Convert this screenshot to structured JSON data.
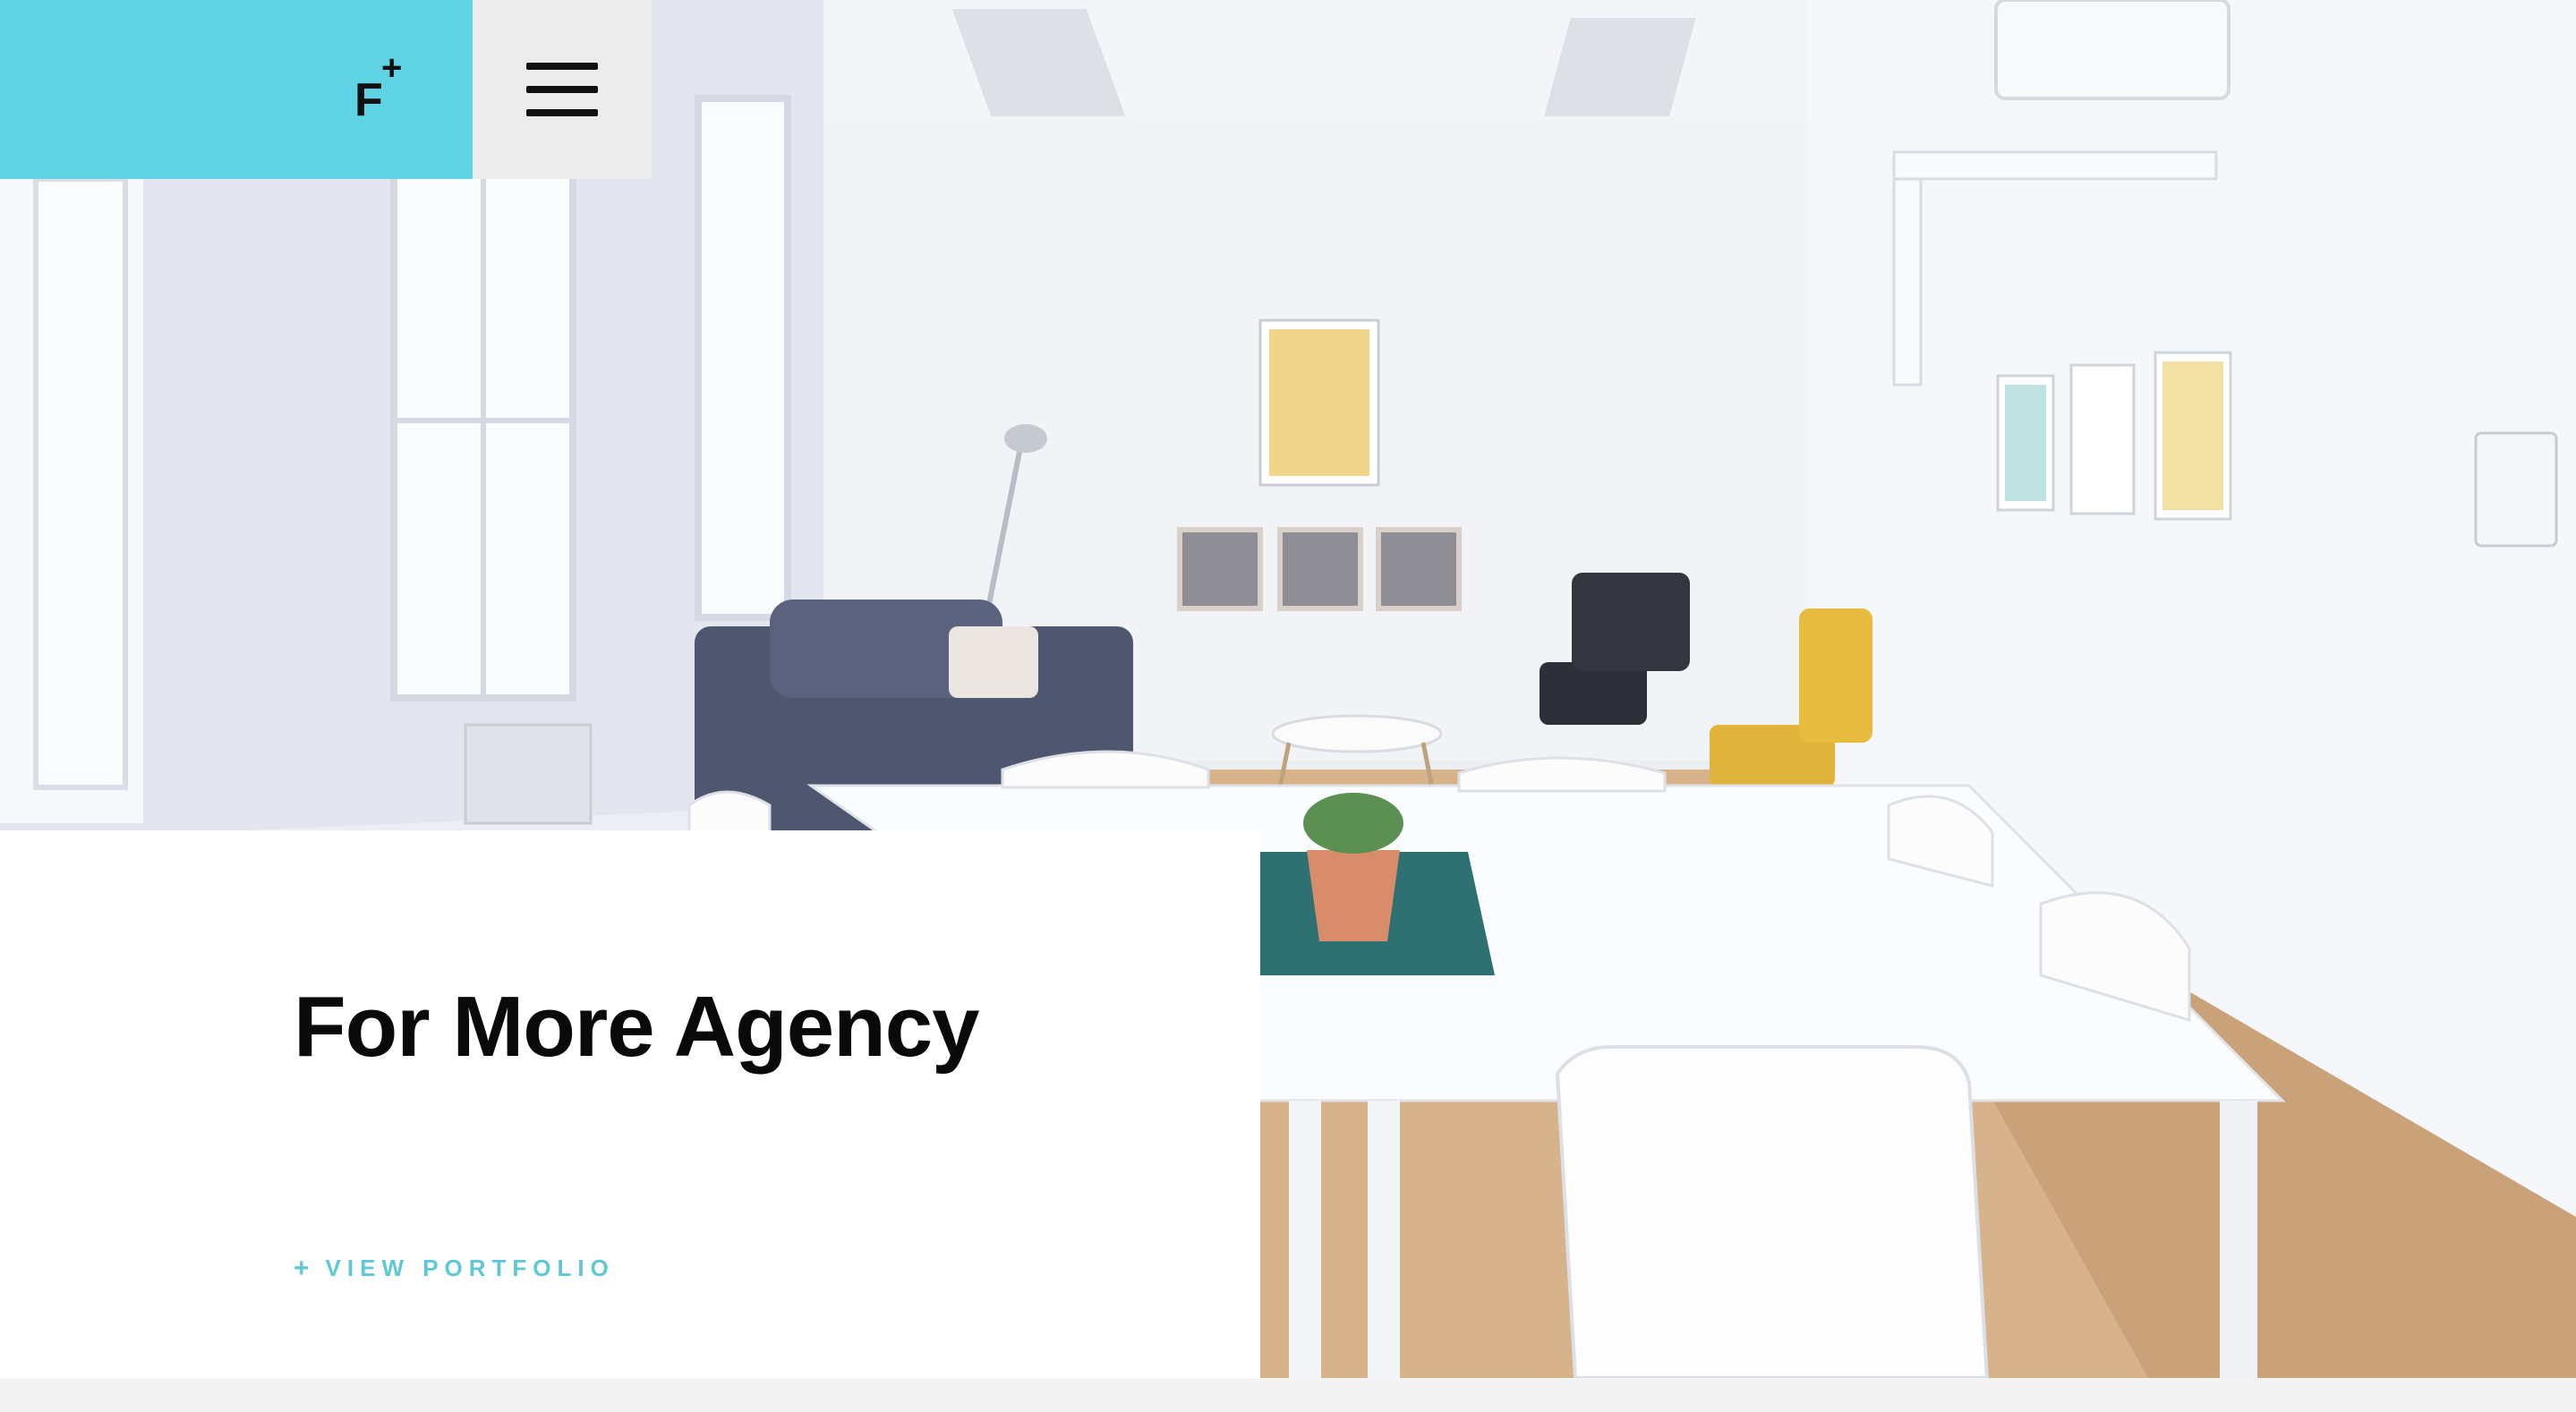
{
  "header": {
    "logo_letter": "F",
    "logo_superscript": "+",
    "brand_color": "#5fd3e3",
    "menu_icon": "hamburger-icon"
  },
  "hero": {
    "background_image": "bright white office interior with white table, sofa, chairs and framed posters",
    "title": "For More Agency",
    "cta_icon": "+",
    "cta_label": "VIEW PORTFOLIO",
    "accent_color": "#5fc8d8"
  }
}
